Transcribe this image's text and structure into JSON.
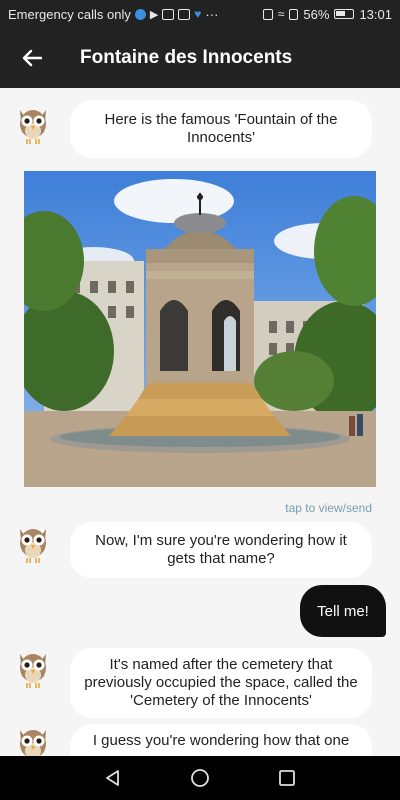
{
  "status_bar": {
    "carrier_text": "Emergency calls only",
    "battery": "56%",
    "time": "13:01",
    "icons": [
      "shield-icon",
      "play-store-icon",
      "mail-icon",
      "news-icon",
      "heart-icon",
      "more-icon",
      "nfc-icon",
      "wifi-icon",
      "sim-icon",
      "battery-icon"
    ]
  },
  "app_bar": {
    "back_icon": "arrow-left-icon",
    "title": "Fontaine des Innocents"
  },
  "messages": {
    "bot_1": "Here is the famous 'Fountain of the Innocents'",
    "image_hint": "tap to view/send",
    "bot_2": "Now, I'm sure you're wondering how it gets that name?",
    "user_1": "Tell me!",
    "bot_3": "It's named after the cemetery that previously occupied the space, called the 'Cemetery of the Innocents'",
    "bot_4": "I guess you're wondering how that one"
  },
  "nav_bar": {
    "icons": [
      "back-triangle-icon",
      "home-circle-icon",
      "recents-square-icon"
    ]
  },
  "colors": {
    "header": "#232323",
    "chat_background": "#f5f5f5",
    "bot_bubble": "#ffffff",
    "user_bubble": "#111111",
    "hint_text": "#7a9bb0"
  }
}
